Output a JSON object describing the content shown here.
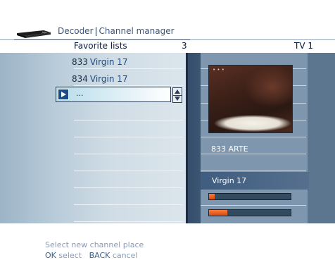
{
  "header": {
    "breadcrumb_root": "Decoder",
    "breadcrumb_current": "Channel manager",
    "icon": "decoder-box-icon"
  },
  "columns": {
    "favorites": "Favorite lists",
    "number": "3",
    "tv": "TV 1"
  },
  "list": {
    "items": [
      {
        "number": "833",
        "name": "Virgin 17"
      },
      {
        "number": "834",
        "name": "Virgin 17"
      }
    ],
    "edit_field": {
      "value": "...",
      "icon": "play-icon"
    }
  },
  "info": {
    "preview_overlay": "• • •",
    "channel": "833 ARTE",
    "selected_name": "Virgin 17",
    "signal_bars": [
      {
        "level": 0.07
      },
      {
        "level": 0.22
      }
    ]
  },
  "footer": {
    "line1": "Select new channel place",
    "ok_key": "OK",
    "ok_action": "select",
    "back_key": "BACK",
    "back_action": "cancel"
  },
  "colors": {
    "accent": "#1e4a86",
    "signal": "#ff7a3a",
    "panel_dark": "#344d6b"
  }
}
